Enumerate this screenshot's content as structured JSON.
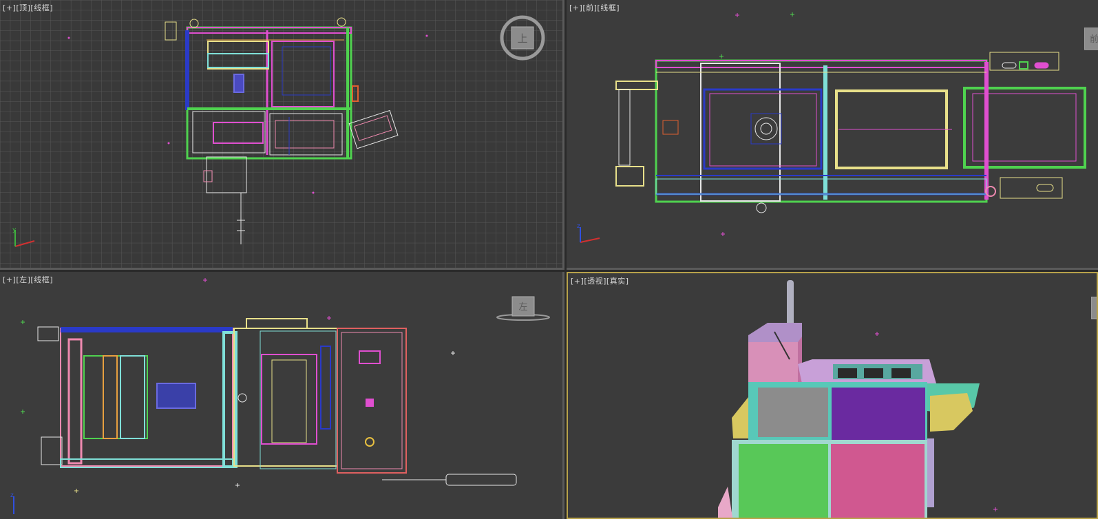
{
  "viewports": {
    "top": {
      "plus": "[+]",
      "view": "[顶]",
      "mode": "[线框]",
      "cube_face": "上"
    },
    "front": {
      "plus": "[+]",
      "view": "[前]",
      "mode": "[线框]",
      "cube_face": "前"
    },
    "left": {
      "plus": "[+]",
      "view": "[左]",
      "mode": "[线框]",
      "cube_face": "左"
    },
    "persp": {
      "plus": "[+]",
      "view": "[透视]",
      "mode": "[真实]"
    }
  },
  "colors": {
    "grid": "#4e4e4e",
    "active_border": "#b8a24a",
    "green": "#4fd24f",
    "magenta": "#e04fd0",
    "blue": "#2a3ac8",
    "cyan": "#7fe0d8",
    "yellow": "#e8e08a",
    "pink": "#f08ab0",
    "white": "#e8e8e8",
    "purple": "#6a2aa0",
    "gray": "#8a8a8a"
  },
  "axis_labels": {
    "top": "y",
    "front": "z",
    "left": "z"
  }
}
